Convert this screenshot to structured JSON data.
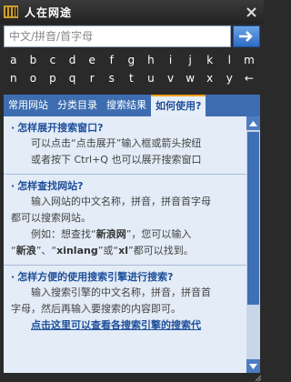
{
  "window": {
    "title": "人在网途"
  },
  "search": {
    "placeholder": "中文/拼音/首字母",
    "value": ""
  },
  "letters": {
    "row1": [
      "a",
      "b",
      "c",
      "d",
      "e",
      "f",
      "g",
      "h",
      "i",
      "j",
      "k",
      "l",
      "m"
    ],
    "row2": [
      "n",
      "o",
      "p",
      "q",
      "r",
      "s",
      "t",
      "u",
      "v",
      "w",
      "x",
      "y",
      "z"
    ],
    "back": "←"
  },
  "tabs": [
    {
      "label": "常用网站"
    },
    {
      "label": "分类目录"
    },
    {
      "label": "搜索结果"
    },
    {
      "label": "如何使用?"
    }
  ],
  "help": {
    "s1": {
      "q": "怎样展开搜索窗口?",
      "p1": "可以点击“点击展开”输入框或箭头按纽",
      "p2": "或者按下 Ctrl+Q 也可以展开搜索窗口"
    },
    "s2": {
      "q": "怎样查找网站?",
      "p1": "输入网站的中文名称，拼音，拼音首字母",
      "p2": "都可以搜索网站。",
      "p3a": "例如：想查找“",
      "p3b": "新浪网",
      "p3c": "”，您可以输入",
      "p4a": "“",
      "p4b": "新浪",
      "p4c": "”、“",
      "p4d": "xinlang",
      "p4e": "”或“",
      "p4f": "xl",
      "p4g": "”都可以找到。"
    },
    "s3": {
      "q": "怎样方便的使用搜索引擎进行搜索?",
      "p1": "输入搜索引擎的中文名称，拼音，拼音首",
      "p2": "字母，然后再输入要搜索的内容即可。",
      "link": "点击这里可以查看各搜索引擎的搜索代"
    }
  },
  "colors": {
    "accent": "#3d6db0",
    "panel": "#e3ecf7",
    "title_bg": "#2a2a2a",
    "tab_active": "#e6eef8",
    "tab_top": "#f0a020"
  },
  "icons": [
    "app-logo-icon",
    "close-icon",
    "arrow-right-icon",
    "scroll-up-icon",
    "scroll-down-icon",
    "resize-grip-icon"
  ]
}
